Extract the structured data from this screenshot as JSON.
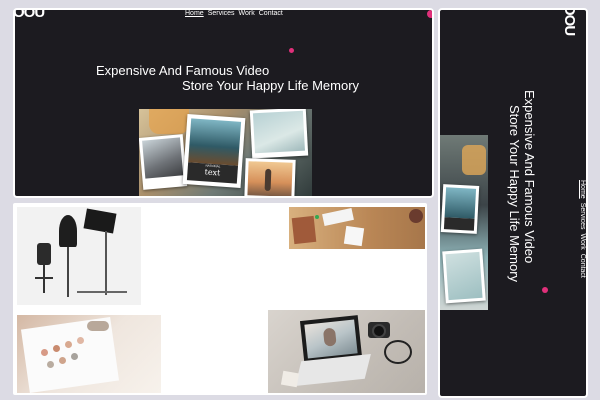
{
  "hero": {
    "logo": "OOU",
    "nav": [
      {
        "label": "Home",
        "active": true
      },
      {
        "label": "Services"
      },
      {
        "label": "Work"
      },
      {
        "label": "Contact"
      }
    ],
    "headline_line1": "Expensive And Famous Video",
    "headline_line2": "Store Your Happy Life Memory",
    "polaroid_caption_small": "NATIONAL",
    "polaroid_caption_large": "text"
  },
  "vertical": {
    "logo": "OOU",
    "headline_line1": "Expensive And Famous Video",
    "headline_line2": "Store Your Happy Life Memory",
    "nav": [
      {
        "label": "Home",
        "active": true
      },
      {
        "label": "Services"
      },
      {
        "label": "Work"
      },
      {
        "label": "Contact"
      }
    ]
  },
  "gallery": {
    "images": [
      "photo-studio-lights",
      "desk-with-photos",
      "color-palette-card",
      "laptop-and-camera"
    ]
  },
  "colors": {
    "accent": "#e0307a",
    "dark_bg": "#1c1b20",
    "page_bg": "#dcdbe4"
  }
}
